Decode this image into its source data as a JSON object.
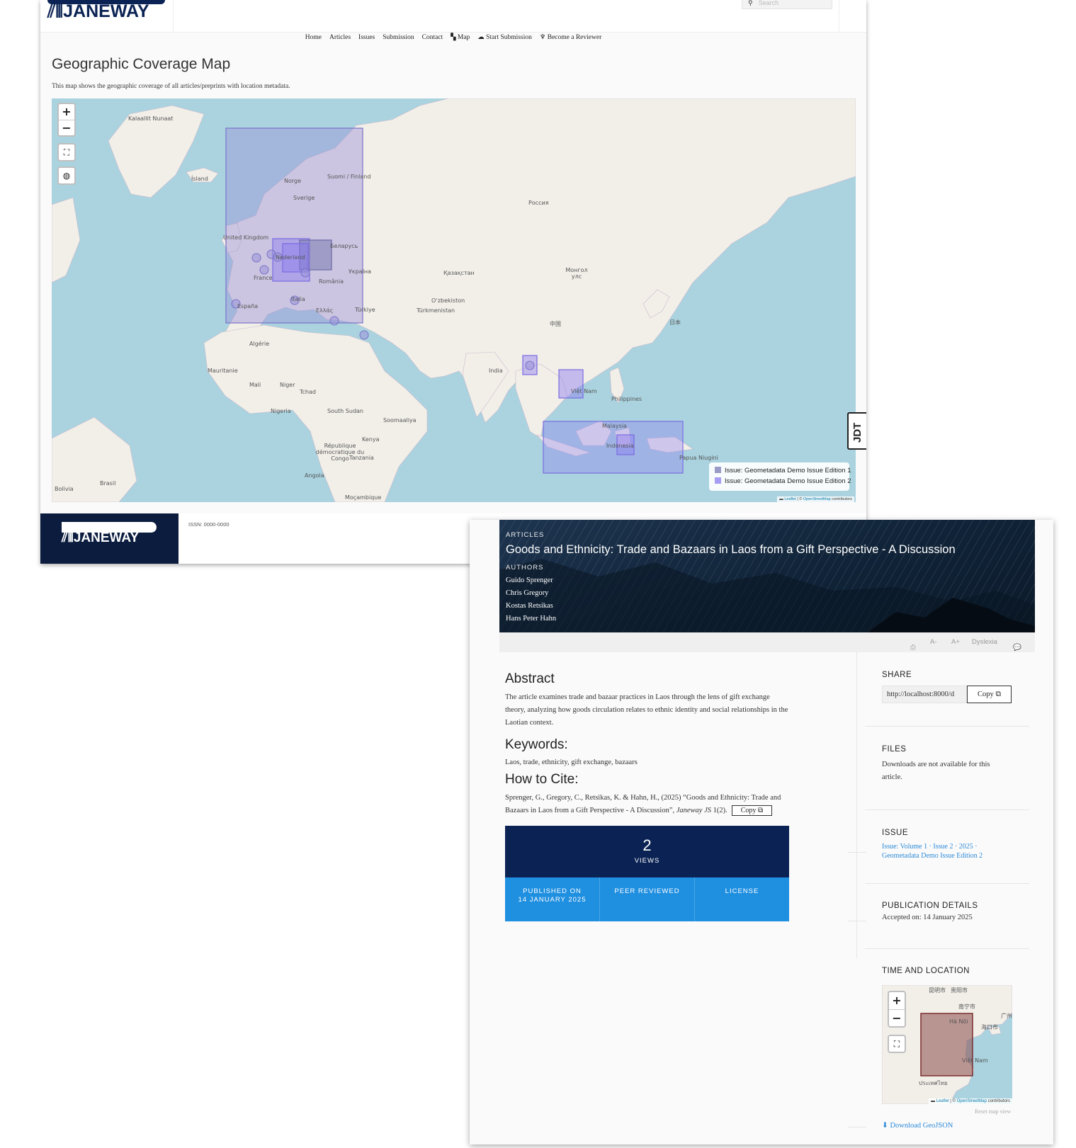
{
  "site": {
    "logo_text": "JANEWAY",
    "search_placeholder": "Search",
    "nav": [
      "Home",
      "Articles",
      "Issues",
      "Submission",
      "Contact",
      "Map",
      "Start Submission",
      "Become a Reviewer"
    ]
  },
  "map_page": {
    "title": "Geographic Coverage Map",
    "description": "This map shows the geographic coverage of all articles/preprints with location metadata.",
    "legend": [
      {
        "label": "Issue: Geometadata Demo Issue Edition 1",
        "color": "#7b7bb3"
      },
      {
        "label": "Issue: Geometadata Demo Issue Edition 2",
        "color": "#8b7cf0"
      }
    ],
    "attribution": {
      "leaflet": "Leaflet",
      "sep": " | © ",
      "osm": "OpenStreetMap",
      "tail": " contributors"
    },
    "place_labels": [
      "Kalaallit Nunaat",
      "Ísland",
      "Norge",
      "Suomi / Finland",
      "Sverige",
      "United Kingdom",
      "Nederland",
      "Беларусь",
      "France",
      "România",
      "Україна",
      "España",
      "Italia",
      "Ελλάς",
      "Türkiye",
      "Россия",
      "Қазақстан",
      "Oʻzbekiston",
      "Türkmenistan",
      "Монгол улс",
      "中国",
      "日本",
      "Algérie",
      "Mauritanie",
      "Mali",
      "Niger",
      "Tchad",
      "Nigeria",
      "South Sudan",
      "Soomaaliya",
      "Kenya",
      "République démocratique du Congo",
      "Tanzania",
      "Angola",
      "Moçambique",
      "Brasil",
      "Bolivia",
      "India",
      "Việt Nam",
      "Philippines",
      "Malaysia",
      "Indonesia",
      "Papua Niugini"
    ]
  },
  "debug_toolbar": "DJDT",
  "footer": {
    "logo_text": "JANEWAY",
    "issn": "ISSN: 0000-0000"
  },
  "article": {
    "section_label": "ARTICLES",
    "title": "Goods and Ethnicity: Trade and Bazaars in Laos from a Gift Perspective - A Discussion",
    "authors_label": "AUTHORS",
    "authors": [
      "Guido Sprenger",
      "Chris Gregory",
      "Kostas Retsikas",
      "Hans Peter Hahn"
    ],
    "toolbar": {
      "font_smaller": "A-",
      "font_larger": "A+",
      "dyslexia": "Dyslexia"
    },
    "abstract_heading": "Abstract",
    "abstract": "The article examines trade and bazaar practices in Laos through the lens of gift exchange theory, analyzing how goods circulation relates to ethnic identity and social relationships in the Laotian context.",
    "keywords_heading": "Keywords:",
    "keywords": "Laos, trade, ethnicity, gift exchange, bazaars",
    "cite_heading": "How to Cite:",
    "citation_plain": "Sprenger, G., Gregory, C., Retsikas, K. & Hahn, H., (2025) “Goods and Ethnicity: Trade and Bazaars in Laos from a Gift Perspective - A Discussion”, ",
    "citation_journal": "Janeway JS",
    "citation_issue": " 1(2).",
    "copy_label": "Copy",
    "views_count": "2",
    "views_label": "VIEWS",
    "published_label": "PUBLISHED ON",
    "published_date": "14 JANUARY 2025",
    "peer_reviewed": "PEER REVIEWED",
    "license": "LICENSE"
  },
  "sidebar": {
    "share_heading": "SHARE",
    "share_url": "http://localhost:8000/d",
    "share_copy": "Copy",
    "files_heading": "FILES",
    "files_text": "Downloads are not available for this article.",
    "issue_heading": "ISSUE",
    "issue_link": "Issue: Volume 1 · Issue 2 · 2025 · Geometadata Demo Issue Edition 2",
    "pub_heading": "PUBLICATION DETAILS",
    "accepted": "Accepted on: 14 January 2025",
    "time_loc_heading": "TIME AND LOCATION",
    "mini_map_labels": [
      "昆明市",
      "贵阳市",
      "南宁市",
      "广州",
      "Hà Nội",
      "海口市",
      "Việt Nam",
      "ประเทศไทย"
    ],
    "reset_view": "Reset map view",
    "download": "Download GeoJSON"
  }
}
